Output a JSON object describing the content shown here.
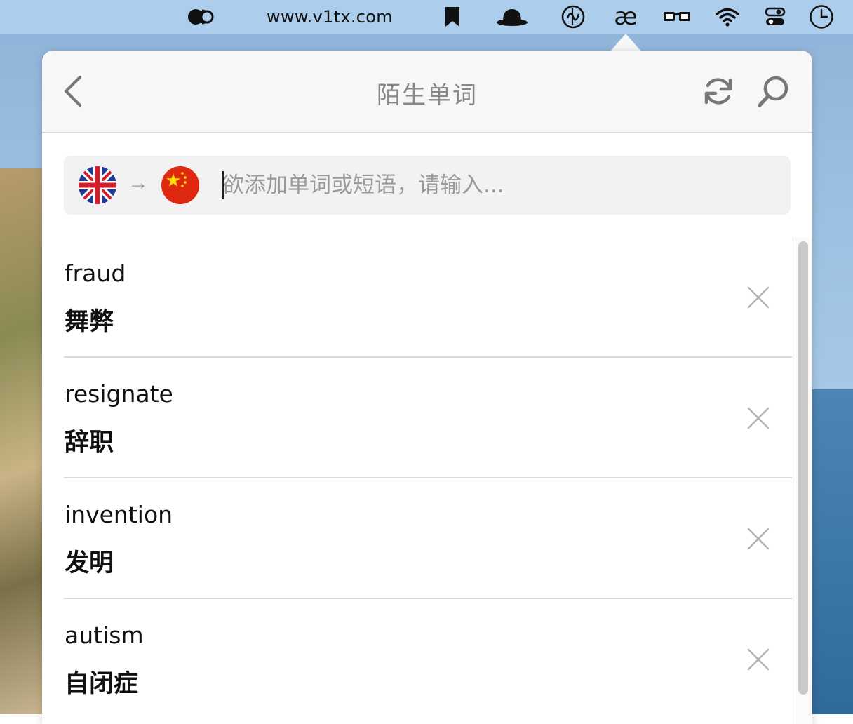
{
  "menubar": {
    "url": "www.v1tx.com",
    "icons": [
      "toggle-icon",
      "bookmark-icon",
      "bowler-hat-icon",
      "circle-logo-icon",
      "ae-icon",
      "glasses-icon",
      "wifi-icon",
      "control-center-icon",
      "clock-icon"
    ],
    "ae_label": "æ"
  },
  "popover": {
    "title": "陌生单词",
    "input": {
      "placeholder": "欲添加单词或短语，请输入...",
      "value": "",
      "source_lang": "en-GB",
      "target_lang": "zh-CN",
      "arrow": "→"
    },
    "words": [
      {
        "en": "fraud",
        "zh": "舞弊"
      },
      {
        "en": "resignate",
        "zh": "辞职"
      },
      {
        "en": "invention",
        "zh": "发明"
      },
      {
        "en": "autism",
        "zh": "自闭症"
      }
    ]
  },
  "colors": {
    "menubar_bg": "#afcfee",
    "header_bg": "#f7f7f7",
    "icon_gray": "#777777",
    "text": "#111111",
    "placeholder": "#9a9a9a"
  }
}
